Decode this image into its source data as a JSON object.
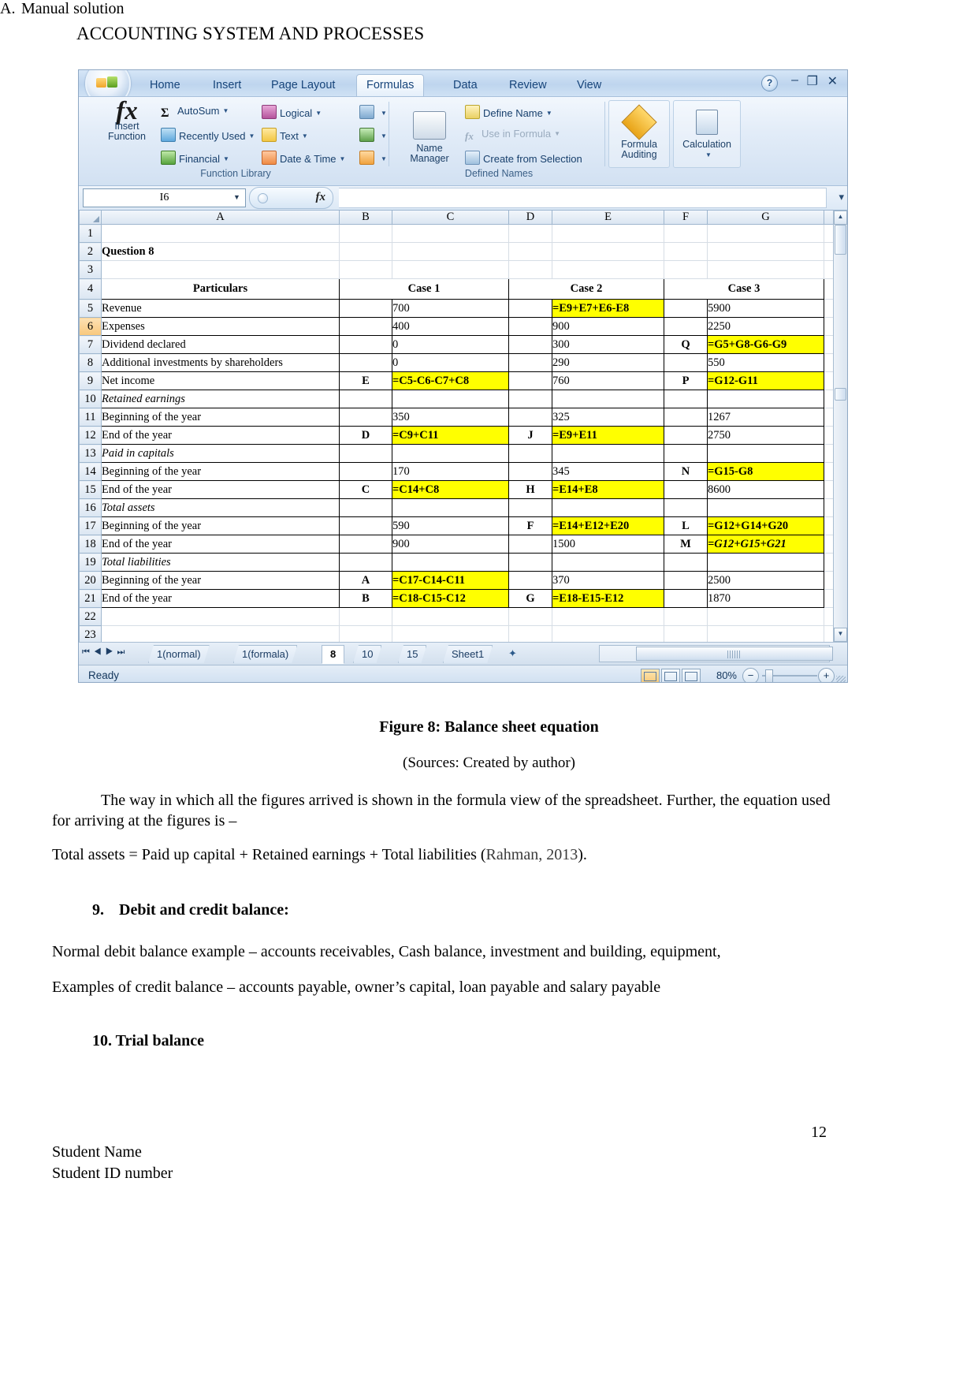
{
  "document": {
    "header": "ACCOUNTING SYSTEM AND PROCESSES",
    "figure_caption": "Figure 8: Balance sheet equation",
    "figure_source": "(Sources: Created by author)",
    "paragraph_1": "The way in which all the figures arrived is shown in the formula view of the spreadsheet. Further, the equation used for arriving at the figures is –",
    "paragraph_2_main": "Total assets = Paid up capital + Retained earnings + Total liabilities (",
    "paragraph_2_cite": "Rahman, 2013",
    "paragraph_2_end": ").",
    "heading_9_num": "9.",
    "heading_9": "Debit and credit balance:",
    "paragraph_3": "Normal debit balance example – accounts receivables, Cash balance, investment and building, equipment,",
    "paragraph_4": "Examples of credit balance – accounts payable, owner’s capital, loan payable and salary payable",
    "heading_10": "10. Trial balance",
    "item_a_num": "A.",
    "item_a": "Manual solution",
    "page_number": "12",
    "footer_line_1": "Student Name",
    "footer_line_2": "Student ID number"
  },
  "excel": {
    "ribbon_tabs": [
      {
        "label": "Home",
        "active": false
      },
      {
        "label": "Insert",
        "active": false
      },
      {
        "label": "Page Layout",
        "active": false
      },
      {
        "label": "Formulas",
        "active": true
      },
      {
        "label": "Data",
        "active": false
      },
      {
        "label": "Review",
        "active": false
      },
      {
        "label": "View",
        "active": false
      }
    ],
    "window_controls": {
      "help": "?",
      "minimize": "–",
      "restore": "❐",
      "close": "✕"
    },
    "groups": {
      "function_library": {
        "label": "Function Library",
        "insert_function": "Insert\nFunction",
        "insert_function_line1": "Insert",
        "insert_function_line2": "Function",
        "items": [
          {
            "label": "AutoSum",
            "icon": "sigma-icon",
            "dropdown": true
          },
          {
            "label": "Recently Used",
            "icon": "recently-used-icon",
            "dropdown": true
          },
          {
            "label": "Financial",
            "icon": "financial-icon",
            "dropdown": true
          },
          {
            "label": "Logical",
            "icon": "logical-icon",
            "dropdown": true
          },
          {
            "label": "Text",
            "icon": "text-icon",
            "dropdown": true
          },
          {
            "label": "Date & Time",
            "icon": "date-time-icon",
            "dropdown": true
          }
        ]
      },
      "defined_names": {
        "label": "Defined Names",
        "name_manager_line1": "Name",
        "name_manager_line2": "Manager",
        "items": [
          {
            "label": "Define Name",
            "icon": "define-name-icon",
            "dropdown": true,
            "disabled": false
          },
          {
            "label": "Use in Formula",
            "icon": "use-in-formula-icon",
            "dropdown": true,
            "disabled": true
          },
          {
            "label": "Create from Selection",
            "icon": "create-from-selection-icon",
            "dropdown": false,
            "disabled": false
          }
        ]
      },
      "formula_auditing": {
        "line1": "Formula",
        "line2": "Auditing"
      },
      "calculation": {
        "line1": "Calculation",
        "line2": ""
      }
    },
    "name_box": "I6",
    "formula_bar_value": "",
    "column_headers": [
      "A",
      "B",
      "C",
      "D",
      "E",
      "F",
      "G"
    ],
    "row_numbers": [
      "1",
      "2",
      "3",
      "4",
      "5",
      "6",
      "7",
      "8",
      "9",
      "10",
      "11",
      "12",
      "13",
      "14",
      "15",
      "16",
      "17",
      "18",
      "19",
      "20",
      "21",
      "22",
      "23"
    ],
    "selected_row": "6",
    "sheet_tabs": [
      {
        "label": "1(normal)",
        "active": false
      },
      {
        "label": "1(formala)",
        "active": false
      },
      {
        "label": "8",
        "active": true
      },
      {
        "label": "10",
        "active": false
      },
      {
        "label": "15",
        "active": false
      },
      {
        "label": "Sheet1",
        "active": false
      }
    ],
    "status": "Ready",
    "zoom_level": "80%",
    "view_buttons": [
      "normal-view",
      "page-layout-view",
      "page-break-view"
    ]
  },
  "sheet_data": {
    "title_cell": "Question 8",
    "headers": {
      "a": "Particulars",
      "c": "Case 1",
      "e": "Case 2",
      "g": "Case 3"
    },
    "rows": [
      {
        "n": "1",
        "a": "",
        "b": "",
        "c": "",
        "d": "",
        "e": "",
        "f": "",
        "g": "",
        "type": "empty"
      },
      {
        "n": "2",
        "a": "Question 8",
        "b": "",
        "c": "",
        "d": "",
        "e": "",
        "f": "",
        "g": "",
        "type": "title"
      },
      {
        "n": "3",
        "a": "",
        "b": "",
        "c": "",
        "d": "",
        "e": "",
        "f": "",
        "g": "",
        "type": "empty"
      },
      {
        "n": "4",
        "a": "Particulars",
        "b": "",
        "c": "Case 1",
        "d": "",
        "e": "Case 2",
        "f": "",
        "g": "Case 3",
        "type": "header"
      },
      {
        "n": "5",
        "a": "Revenue",
        "b": "",
        "c": "700",
        "d": "",
        "e": "=E9+E7+E6-E8",
        "f": "",
        "g": "5900",
        "hl": [
          "e"
        ]
      },
      {
        "n": "6",
        "a": "Expenses",
        "b": "",
        "c": "400",
        "d": "",
        "e": "900",
        "f": "",
        "g": "2250",
        "hl": []
      },
      {
        "n": "7",
        "a": "Dividend declared",
        "b": "",
        "c": "0",
        "d": "",
        "e": "300",
        "f": "Q",
        "g": "=G5+G8-G6-G9",
        "hl": [
          "g"
        ]
      },
      {
        "n": "8",
        "a": "Additional investments by shareholders",
        "b": "",
        "c": "0",
        "d": "",
        "e": "290",
        "f": "",
        "g": "550",
        "hl": []
      },
      {
        "n": "9",
        "a": "Net income",
        "b": "E",
        "c": "=C5-C6-C7+C8",
        "d": "",
        "e": "760",
        "f": "P",
        "g": "=G12-G11",
        "hl": [
          "c",
          "g"
        ]
      },
      {
        "n": "10",
        "a": "Retained earnings",
        "b": "",
        "c": "",
        "d": "",
        "e": "",
        "f": "",
        "g": "",
        "type": "subhead"
      },
      {
        "n": "11",
        "a": "Beginning of the year",
        "b": "",
        "c": "350",
        "d": "",
        "e": "325",
        "f": "",
        "g": "1267",
        "hl": []
      },
      {
        "n": "12",
        "a": "End of the year",
        "b": "D",
        "c": "=C9+C11",
        "d": "J",
        "e": "=E9+E11",
        "f": "",
        "g": "2750",
        "hl": [
          "c",
          "e"
        ]
      },
      {
        "n": "13",
        "a": "Paid in capitals",
        "b": "",
        "c": "",
        "d": "",
        "e": "",
        "f": "",
        "g": "",
        "type": "subhead"
      },
      {
        "n": "14",
        "a": "Beginning of the year",
        "b": "",
        "c": "170",
        "d": "",
        "e": "345",
        "f": "N",
        "g": "=G15-G8",
        "hl": [
          "g"
        ]
      },
      {
        "n": "15",
        "a": "End of the year",
        "b": "C",
        "c": "=C14+C8",
        "d": "H",
        "e": "=E14+E8",
        "f": "",
        "g": "8600",
        "hl": [
          "c",
          "e"
        ]
      },
      {
        "n": "16",
        "a": "Total assets",
        "b": "",
        "c": "",
        "d": "",
        "e": "",
        "f": "",
        "g": "",
        "type": "subhead"
      },
      {
        "n": "17",
        "a": "Beginning of the year",
        "b": "",
        "c": "590",
        "d": "F",
        "e": "=E14+E12+E20",
        "f": "L",
        "g": "=G12+G14+G20",
        "hl": [
          "e",
          "g"
        ]
      },
      {
        "n": "18",
        "a": "End of the year",
        "b": "",
        "c": "900",
        "d": "",
        "e": "1500",
        "f": "M",
        "g": "=G12+G15+G21",
        "hl": [
          "g"
        ],
        "italic_g": true
      },
      {
        "n": "19",
        "a": "Total liabilities",
        "b": "",
        "c": "",
        "d": "",
        "e": "",
        "f": "",
        "g": "",
        "type": "subhead"
      },
      {
        "n": "20",
        "a": "Beginning of the year",
        "b": "A",
        "c": "=C17-C14-C11",
        "d": "",
        "e": "370",
        "f": "",
        "g": "2500",
        "hl": [
          "c"
        ]
      },
      {
        "n": "21",
        "a": "End of the year",
        "b": "B",
        "c": "=C18-C15-C12",
        "d": "G",
        "e": "=E18-E15-E12",
        "f": "",
        "g": "1870",
        "hl": [
          "c",
          "e"
        ]
      },
      {
        "n": "22",
        "a": "",
        "b": "",
        "c": "",
        "d": "",
        "e": "",
        "f": "",
        "g": "",
        "type": "edge"
      },
      {
        "n": "23",
        "a": "",
        "b": "",
        "c": "",
        "d": "",
        "e": "",
        "f": "",
        "g": "",
        "type": "empty"
      }
    ]
  },
  "colors": {
    "highlight": "#ffff00",
    "ribbon_text": "#16447a",
    "selected_row_header": "#f8c77c"
  }
}
